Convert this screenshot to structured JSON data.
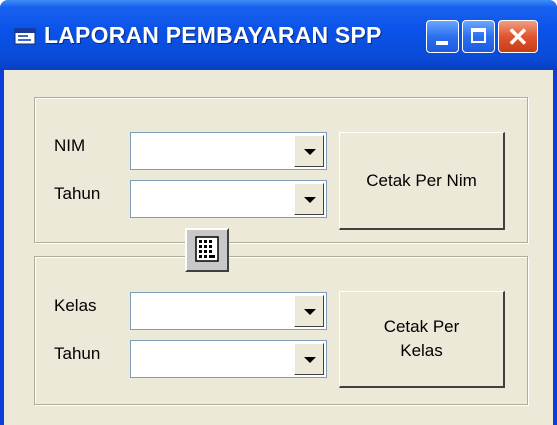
{
  "window": {
    "title": "LAPORAN PEMBAYARAN SPP",
    "title_icon": "window-app-icon",
    "controls": [
      "minimize",
      "maximize",
      "close"
    ]
  },
  "frame_nim": {
    "nim_label": "NIM",
    "nim_value": "",
    "tahun_label": "Tahun",
    "tahun_value": "",
    "button_label": "Cetak Per Nim"
  },
  "frame_kelas": {
    "kelas_label": "Kelas",
    "kelas_value": "",
    "tahun_label": "Tahun",
    "tahun_value": "",
    "button_label": "Cetak Per Kelas"
  },
  "tool_icon": "calculator-grid-icon",
  "colors": {
    "titlebar": "#0a52e8",
    "client_background": "#ece9d8",
    "close_button": "#e05530"
  }
}
